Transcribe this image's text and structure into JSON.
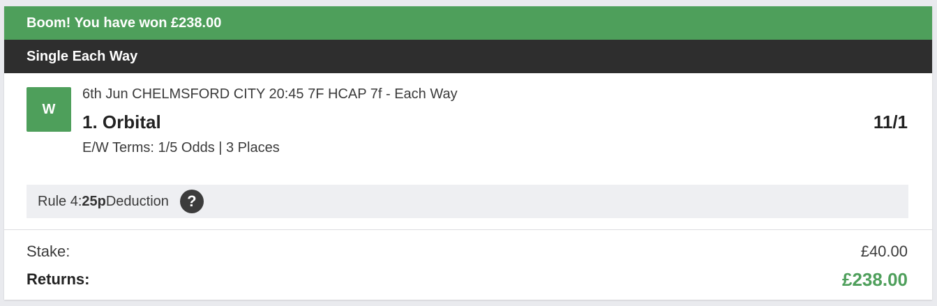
{
  "banner": {
    "text": "Boom! You have won £238.00"
  },
  "bet": {
    "type": "Single Each Way"
  },
  "selection": {
    "result_badge": "W",
    "event": "6th Jun CHELMSFORD CITY 20:45 7F HCAP 7f - Each Way",
    "runner": "1. Orbital",
    "odds": "11/1",
    "ew_terms": "E/W Terms: 1/5 Odds | 3 Places"
  },
  "rule4": {
    "prefix": "Rule 4: ",
    "amount": "25p",
    "suffix": " Deduction",
    "help_icon": "?"
  },
  "totals": {
    "stake_label": "Stake:",
    "stake_value": "£40.00",
    "returns_label": "Returns:",
    "returns_value": "£238.00"
  },
  "colors": {
    "win_green": "#4e9f5b",
    "header_dark": "#2e2e2e",
    "panel_grey": "#eeeff2"
  }
}
